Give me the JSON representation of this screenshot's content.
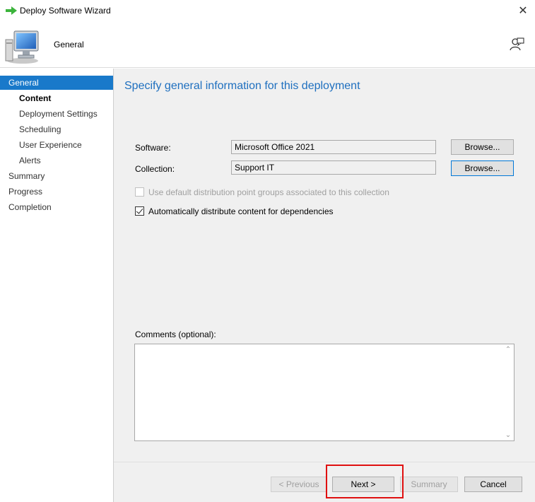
{
  "window": {
    "title": "Deploy Software Wizard",
    "close_glyph": "✕"
  },
  "header": {
    "title": "General",
    "icon": "computer-icon",
    "help_icon": "help-person-icon"
  },
  "nav": {
    "items": [
      {
        "label": "General",
        "state": "active"
      },
      {
        "label": "Content",
        "state": "current"
      },
      {
        "label": "Deployment Settings",
        "state": "normal"
      },
      {
        "label": "Scheduling",
        "state": "normal"
      },
      {
        "label": "User Experience",
        "state": "normal"
      },
      {
        "label": "Alerts",
        "state": "normal"
      },
      {
        "label": "Summary",
        "state": "normal"
      },
      {
        "label": "Progress",
        "state": "normal"
      },
      {
        "label": "Completion",
        "state": "normal"
      }
    ]
  },
  "main": {
    "heading": "Specify general information for this deployment",
    "software_label": "Software:",
    "software_value": "Microsoft Office 2021",
    "collection_label": "Collection:",
    "collection_value": "Support IT",
    "browse_label": "Browse...",
    "default_dp_label": "Use default distribution point groups associated to this collection",
    "default_dp_checked": false,
    "default_dp_enabled": false,
    "auto_distribute_label": "Automatically distribute content for dependencies",
    "auto_distribute_checked": true,
    "comments_label": "Comments (optional):",
    "comments_value": ""
  },
  "footer": {
    "previous_label": "< Previous",
    "next_label": "Next >",
    "summary_label": "Summary",
    "cancel_label": "Cancel"
  },
  "colors": {
    "accent": "#1979ca",
    "heading": "#1e6fbf",
    "highlight": "#e01010"
  }
}
